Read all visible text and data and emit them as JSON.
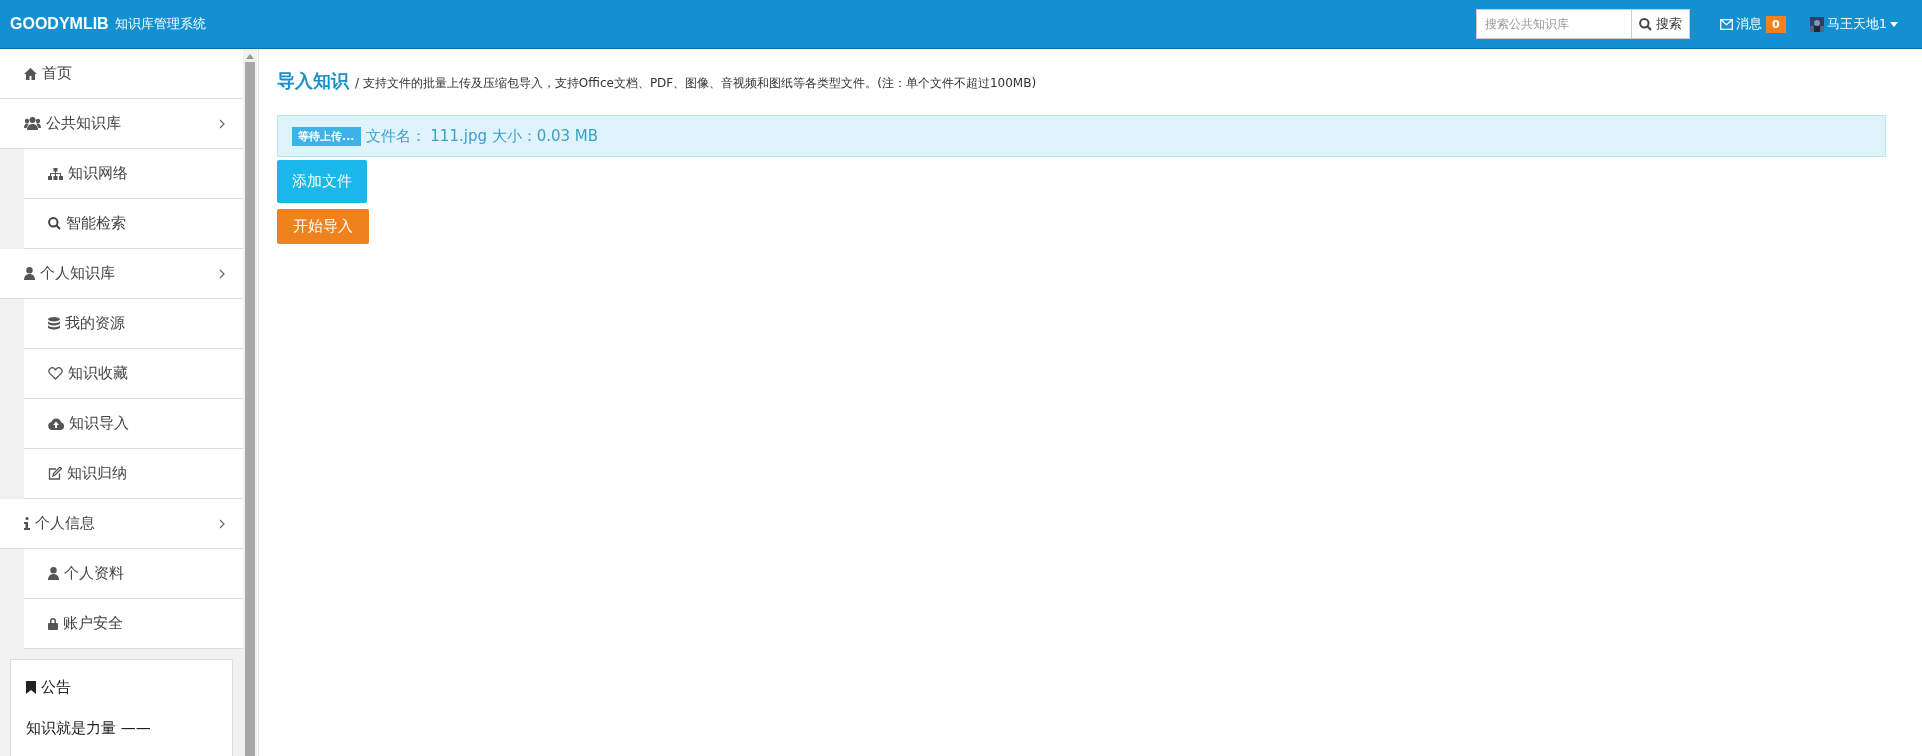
{
  "header": {
    "brand": "GOODYMLIB",
    "subtitle": "知识库管理系统",
    "search": {
      "placeholder": "搜索公共知识库",
      "button": "搜索"
    },
    "messages": {
      "label": "消息",
      "count": "0"
    },
    "user": {
      "name": "马王天地1"
    }
  },
  "sidebar": {
    "items": [
      {
        "label": "首页"
      },
      {
        "label": "公共知识库",
        "children": [
          {
            "label": "知识网络"
          },
          {
            "label": "智能检索"
          }
        ]
      },
      {
        "label": "个人知识库",
        "children": [
          {
            "label": "我的资源"
          },
          {
            "label": "知识收藏"
          },
          {
            "label": "知识导入"
          },
          {
            "label": "知识归纳"
          }
        ]
      },
      {
        "label": "个人信息",
        "children": [
          {
            "label": "个人资料"
          },
          {
            "label": "账户安全"
          }
        ]
      }
    ],
    "notice": {
      "title": "公告",
      "text": "知识就是力量 ——"
    }
  },
  "main": {
    "title": "导入知识",
    "description": "/ 支持文件的批量上传及压缩包导入，支持Office文档、PDF、图像、音视频和图纸等各类型文件。(注：单个文件不超过100MB)",
    "files": [
      {
        "status": "等待上传...",
        "info": "文件名： 111.jpg 大小：0.03 MB"
      }
    ],
    "buttons": [
      {
        "label": "添加文件",
        "kind": "add"
      },
      {
        "label": "开始导入",
        "kind": "start"
      }
    ]
  }
}
